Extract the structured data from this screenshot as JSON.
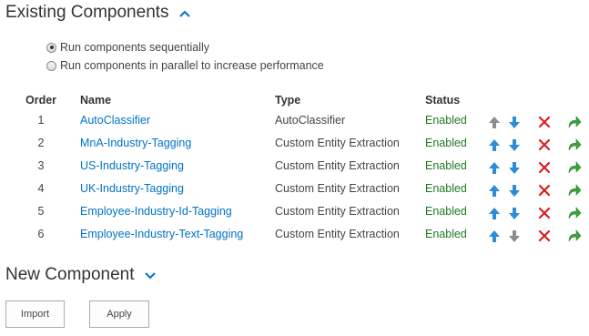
{
  "existing": {
    "title": "Existing Components",
    "icon": "chevron-up-icon"
  },
  "run_options": [
    {
      "label": "Run components sequentially",
      "checked": true
    },
    {
      "label": "Run components in parallel to increase performance",
      "checked": false
    }
  ],
  "table": {
    "headers": {
      "order": "Order",
      "name": "Name",
      "type": "Type",
      "status": "Status"
    },
    "rows": [
      {
        "order": "1",
        "name": "AutoClassifier",
        "type": "AutoClassifier",
        "status": "Enabled",
        "up_enabled": false,
        "down_enabled": true
      },
      {
        "order": "2",
        "name": "MnA-Industry-Tagging",
        "type": "Custom Entity Extraction",
        "status": "Enabled",
        "up_enabled": true,
        "down_enabled": true
      },
      {
        "order": "3",
        "name": "US-Industry-Tagging",
        "type": "Custom Entity Extraction",
        "status": "Enabled",
        "up_enabled": true,
        "down_enabled": true
      },
      {
        "order": "4",
        "name": "UK-Industry-Tagging",
        "type": "Custom Entity Extraction",
        "status": "Enabled",
        "up_enabled": true,
        "down_enabled": true
      },
      {
        "order": "5",
        "name": "Employee-Industry-Id-Tagging",
        "type": "Custom Entity Extraction",
        "status": "Enabled",
        "up_enabled": true,
        "down_enabled": true
      },
      {
        "order": "6",
        "name": "Employee-Industry-Text-Tagging",
        "type": "Custom Entity Extraction",
        "status": "Enabled",
        "up_enabled": true,
        "down_enabled": false
      }
    ]
  },
  "new_component": {
    "title": "New Component",
    "icon": "chevron-down-icon"
  },
  "buttons": {
    "import": "Import",
    "apply": "Apply"
  },
  "colors": {
    "link": "#0072c6",
    "status_enabled": "#217a21",
    "arrow_active": "#2e8bd6",
    "arrow_disabled": "#8c8c8c",
    "delete": "#d91e1e",
    "enable_arrow": "#3aa33a"
  }
}
